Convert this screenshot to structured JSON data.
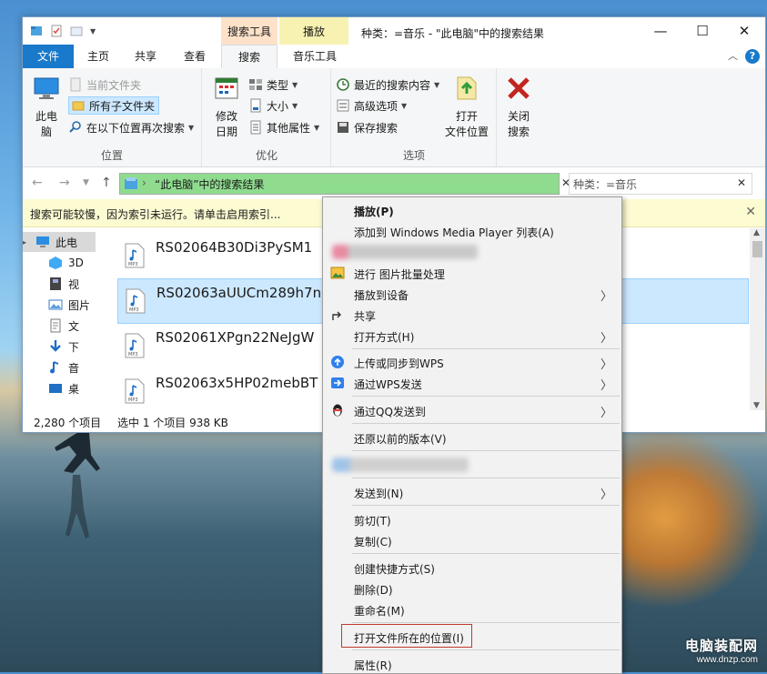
{
  "window": {
    "title": "种类：=音乐 - \"此电脑\"中的搜索结果",
    "contextual_tabs": [
      "搜索工具",
      "播放"
    ]
  },
  "tabs": [
    {
      "label": "文件"
    },
    {
      "label": "主页"
    },
    {
      "label": "共享"
    },
    {
      "label": "查看"
    },
    {
      "label": "搜索"
    },
    {
      "label": "音乐工具"
    }
  ],
  "ribbon": {
    "location": {
      "this_pc": "此电\n脑",
      "current_folder": "当前文件夹",
      "all_subfolders": "所有子文件夹",
      "search_again": "在以下位置再次搜索",
      "group_label": "位置"
    },
    "refine": {
      "date_modified": "修改\n日期",
      "kind": "类型",
      "size": "大小",
      "other_props": "其他属性",
      "group_label": "优化"
    },
    "options": {
      "recent_searches": "最近的搜索内容",
      "advanced": "高级选项",
      "save_search": "保存搜索",
      "open_location": "打开\n文件位置",
      "close_search": "关闭\n搜索",
      "group_label": "选项"
    }
  },
  "address": {
    "path": "“此电脑”中的搜索结果",
    "search_value": "种类：=音乐"
  },
  "infobar": {
    "text": "搜索可能较慢，因为索引未运行。请单击启用索引..."
  },
  "nav_pane": [
    {
      "label": "此电"
    },
    {
      "label": "3D"
    },
    {
      "label": "视"
    },
    {
      "label": "图片"
    },
    {
      "label": "文"
    },
    {
      "label": "下"
    },
    {
      "label": "音"
    },
    {
      "label": "桌"
    }
  ],
  "files": [
    {
      "name": "RS02064B30Di3PySM1",
      "selected": false
    },
    {
      "name": "RS02063aUUCm289h7n",
      "selected": true
    },
    {
      "name": "RS02061XPgn22NeJgW",
      "selected": false
    },
    {
      "name": "RS02063x5HP02mebBT",
      "selected": false
    }
  ],
  "status": {
    "count": "2,280 个项目",
    "selection": "选中 1 个项目  938 KB"
  },
  "context_menu": {
    "play": "播放(P)",
    "add_to_wmp": "添加到 Windows Media Player 列表(A)",
    "batch_images": "进行 图片批量处理",
    "cast": "播放到设备",
    "share": "共享",
    "open_with": "打开方式(H)",
    "upload_wps": "上传或同步到WPS",
    "send_wps": "通过WPS发送",
    "send_qq": "通过QQ发送到",
    "restore": "还原以前的版本(V)",
    "send_to": "发送到(N)",
    "cut": "剪切(T)",
    "copy": "复制(C)",
    "create_shortcut": "创建快捷方式(S)",
    "delete": "删除(D)",
    "rename": "重命名(M)",
    "open_file_location": "打开文件所在的位置(I)",
    "properties": "属性(R)"
  },
  "watermark": {
    "line1": "电脑装配网",
    "line2": "www.dnzp.com"
  },
  "colors": {
    "file_tab": "#1979ca",
    "address_highlight": "#8fdc8f",
    "selection": "#cce8ff",
    "highlight_box": "#c0392b"
  }
}
